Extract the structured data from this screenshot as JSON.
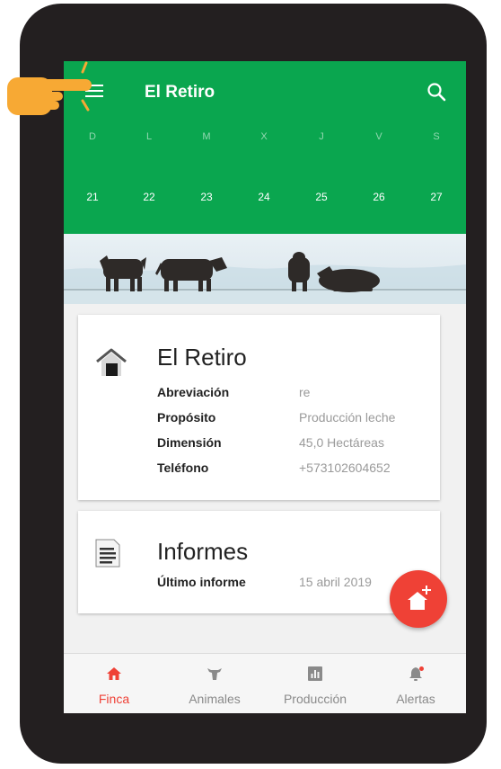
{
  "app": {
    "title": "El Retiro"
  },
  "calendar": {
    "day_names": [
      "D",
      "L",
      "M",
      "X",
      "J",
      "V",
      "S"
    ],
    "day_numbers": [
      "21",
      "22",
      "23",
      "24",
      "25",
      "26",
      "27"
    ]
  },
  "farm_card": {
    "title": "El Retiro",
    "rows": [
      {
        "label": "Abreviación",
        "value": "re"
      },
      {
        "label": "Propósito",
        "value": "Producción leche"
      },
      {
        "label": "Dimensión",
        "value": "45,0 Hectáreas"
      },
      {
        "label": "Teléfono",
        "value": "+573102604652"
      }
    ]
  },
  "reports_card": {
    "title": "Informes",
    "last_label": "Último informe",
    "last_value": "15 abril 2019"
  },
  "bottom_nav": {
    "items": [
      {
        "label": "Finca",
        "icon": "house-icon",
        "active": true
      },
      {
        "label": "Animales",
        "icon": "cow-icon",
        "active": false
      },
      {
        "label": "Producción",
        "icon": "chart-icon",
        "active": false
      },
      {
        "label": "Alertas",
        "icon": "bell-icon",
        "active": false
      }
    ]
  },
  "colors": {
    "appbar": "#0aa64f",
    "accent": "#ef4136",
    "device_frame": "#231f20",
    "pointer_hand": "#f7a934"
  },
  "icons": {
    "menu": "menu-icon",
    "search": "search-icon",
    "fab": "add-farm-icon",
    "farm": "house-icon",
    "reports": "document-icon",
    "pointer": "pointing-hand-icon"
  }
}
